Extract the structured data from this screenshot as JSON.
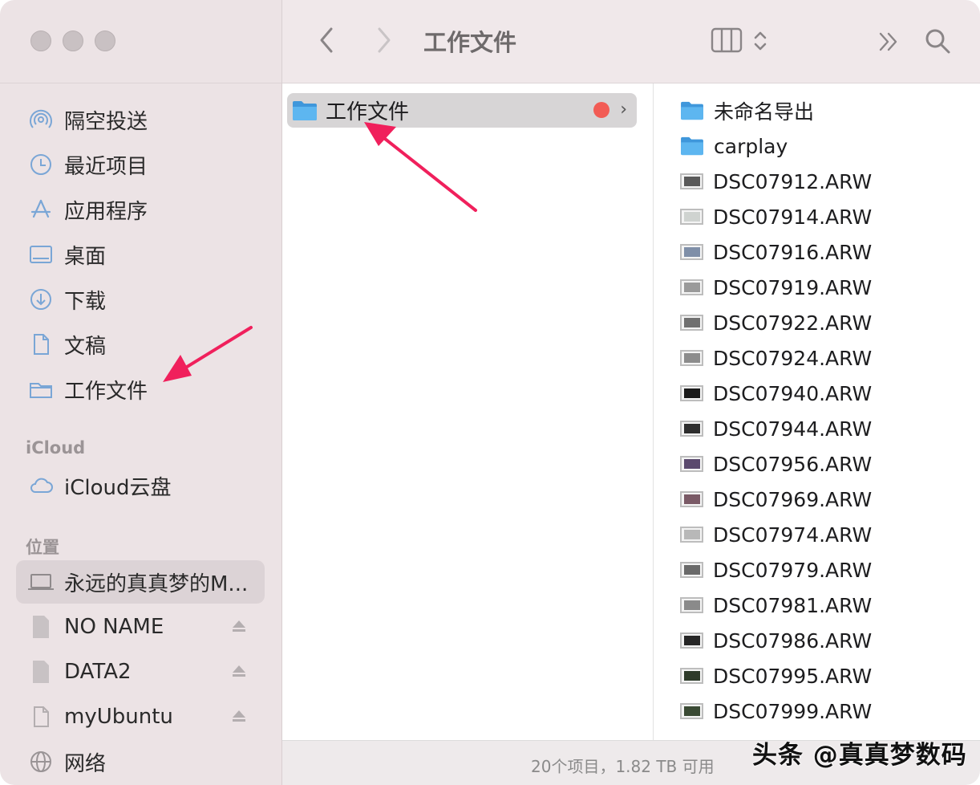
{
  "toolbar": {
    "title": "工作文件",
    "icons": [
      "chevron-left-icon",
      "chevron-right-icon",
      "column-view-icon",
      "sort-updown-icon",
      "more-chevrons-icon",
      "search-icon"
    ]
  },
  "sidebar": {
    "favorites": [
      {
        "label": "隔空投送",
        "icon": "airdrop-icon"
      },
      {
        "label": "最近项目",
        "icon": "clock-icon"
      },
      {
        "label": "应用程序",
        "icon": "apps-icon"
      },
      {
        "label": "桌面",
        "icon": "desktop-icon"
      },
      {
        "label": "下载",
        "icon": "download-icon"
      },
      {
        "label": "文稿",
        "icon": "document-icon"
      },
      {
        "label": "工作文件",
        "icon": "folder-icon"
      }
    ],
    "icloud_heading": "iCloud",
    "icloud": [
      {
        "label": "iCloud云盘",
        "icon": "cloud-icon"
      }
    ],
    "locations_heading": "位置",
    "locations": [
      {
        "label": "永远的真真梦的M...",
        "icon": "laptop-icon",
        "selected": true
      },
      {
        "label": "NO NAME",
        "icon": "drive-icon",
        "eject": true
      },
      {
        "label": "DATA2",
        "icon": "drive-icon",
        "eject": true
      },
      {
        "label": "myUbuntu",
        "icon": "document-icon",
        "eject": true
      },
      {
        "label": "网络",
        "icon": "globe-icon"
      }
    ]
  },
  "column1": {
    "selected_item": {
      "label": "工作文件",
      "tag_color": "#f25c55"
    }
  },
  "column2": {
    "items": [
      {
        "label": "未命名导出",
        "kind": "folder"
      },
      {
        "label": "carplay",
        "kind": "folder"
      },
      {
        "label": "DSC07912.ARW",
        "kind": "image",
        "tone": "#5a5a5a"
      },
      {
        "label": "DSC07914.ARW",
        "kind": "image",
        "tone": "#cfd3d0"
      },
      {
        "label": "DSC07916.ARW",
        "kind": "image",
        "tone": "#7f8fa8"
      },
      {
        "label": "DSC07919.ARW",
        "kind": "image",
        "tone": "#9a9a9a"
      },
      {
        "label": "DSC07922.ARW",
        "kind": "image",
        "tone": "#707070"
      },
      {
        "label": "DSC07924.ARW",
        "kind": "image",
        "tone": "#8c8c8c"
      },
      {
        "label": "DSC07940.ARW",
        "kind": "image",
        "tone": "#1a1a1a"
      },
      {
        "label": "DSC07944.ARW",
        "kind": "image",
        "tone": "#2e2e2e"
      },
      {
        "label": "DSC07956.ARW",
        "kind": "image",
        "tone": "#5b4a6e"
      },
      {
        "label": "DSC07969.ARW",
        "kind": "image",
        "tone": "#7a5a66"
      },
      {
        "label": "DSC07974.ARW",
        "kind": "image",
        "tone": "#b8b8b8"
      },
      {
        "label": "DSC07979.ARW",
        "kind": "image",
        "tone": "#6a6a6a"
      },
      {
        "label": "DSC07981.ARW",
        "kind": "image",
        "tone": "#8a8a8a"
      },
      {
        "label": "DSC07986.ARW",
        "kind": "image",
        "tone": "#262626"
      },
      {
        "label": "DSC07995.ARW",
        "kind": "image",
        "tone": "#2e3b2a"
      },
      {
        "label": "DSC07999.ARW",
        "kind": "image",
        "tone": "#3a4a34"
      }
    ]
  },
  "statusbar": {
    "text": "20个项目，1.82 TB 可用"
  },
  "watermark": "头条 @真真梦数码",
  "colors": {
    "folder_blue": "#4aa8e8",
    "annotation_arrow": "#f0205c",
    "sidebar_bg": "#ece3e5"
  }
}
